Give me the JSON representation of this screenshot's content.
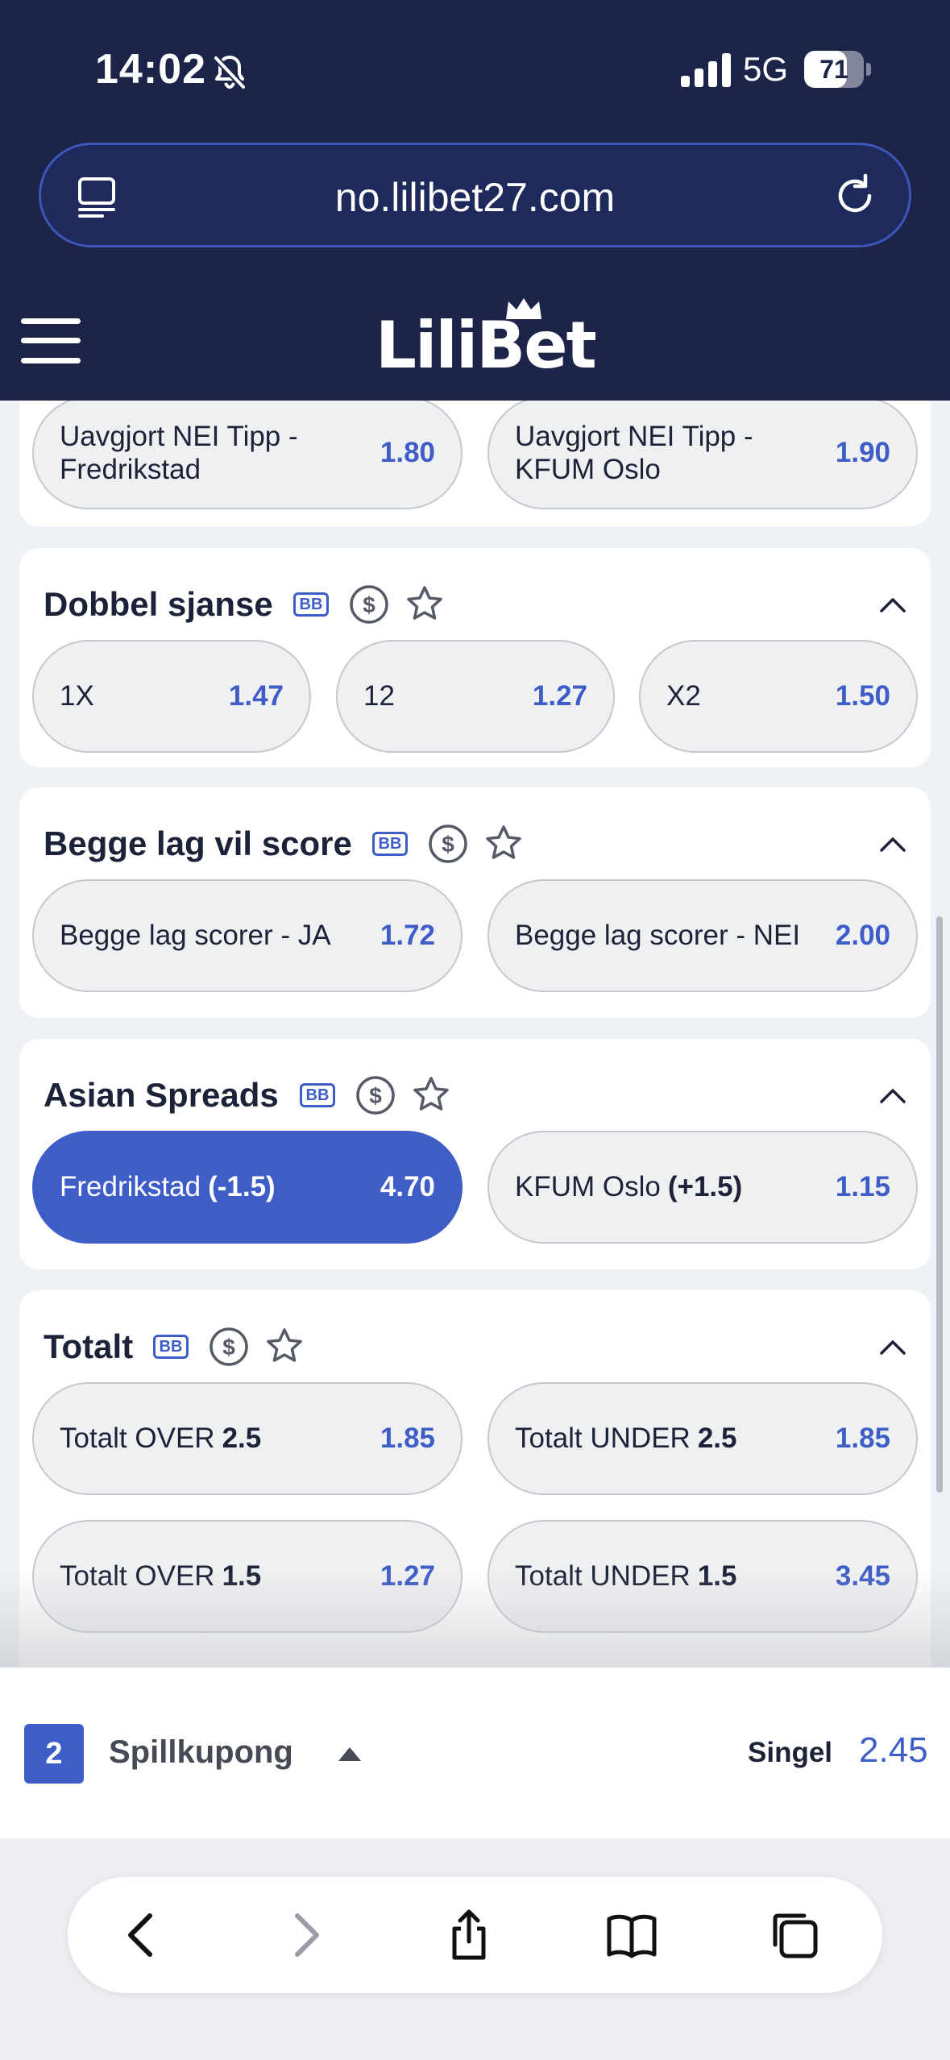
{
  "status_bar": {
    "time": "14:02",
    "network": "5G",
    "battery": "71",
    "battery_level": 0.71
  },
  "browser": {
    "url": "no.lilibet27.com"
  },
  "header": {
    "logo": "LiliBet"
  },
  "partial_card": {
    "odds": [
      {
        "label": "Uavgjort NEI Tipp - Fredrikstad",
        "value": "1.80"
      },
      {
        "label": "Uavgjort NEI Tipp - KFUM Oslo",
        "value": "1.90"
      }
    ]
  },
  "markets": [
    {
      "title": "Dobbel sjanse",
      "badge": "BB",
      "odds": [
        {
          "label": "1X",
          "value": "1.47"
        },
        {
          "label": "12",
          "value": "1.27"
        },
        {
          "label": "X2",
          "value": "1.50"
        }
      ]
    },
    {
      "title": "Begge lag vil score",
      "badge": "BB",
      "odds": [
        {
          "label": "Begge lag scorer - JA",
          "value": "1.72"
        },
        {
          "label": "Begge lag scorer - NEI",
          "value": "2.00"
        }
      ]
    },
    {
      "title": "Asian Spreads",
      "badge": "BB",
      "odds": [
        {
          "label": "Fredrikstad",
          "bold": "(-1.5)",
          "value": "4.70",
          "selected": true
        },
        {
          "label": "KFUM Oslo",
          "bold": "(+1.5)",
          "value": "1.15"
        }
      ]
    },
    {
      "title": "Totalt",
      "badge": "BB",
      "odds": [
        {
          "label": "Totalt OVER",
          "bold": "2.5",
          "value": "1.85"
        },
        {
          "label": "Totalt UNDER",
          "bold": "2.5",
          "value": "1.85"
        },
        {
          "label": "Totalt OVER",
          "bold": "1.5",
          "value": "1.27"
        },
        {
          "label": "Totalt UNDER",
          "bold": "1.5",
          "value": "3.45"
        }
      ]
    }
  ],
  "betslip": {
    "count": "2",
    "label": "Spillkupong",
    "type": "Singel",
    "odds": "2.45"
  },
  "colors": {
    "brand_dark": "#1c2449",
    "accent": "#3f5dc6",
    "odd_bg": "#eff0f2"
  },
  "icons": [
    "bell-slash-icon",
    "signal-icon",
    "battery-icon",
    "page-icon",
    "reload-icon",
    "menu-icon",
    "crown-icon",
    "dollar-icon",
    "star-icon",
    "chevron-up-icon",
    "caret-up-icon",
    "back-icon",
    "forward-icon",
    "share-icon",
    "bookmarks-icon",
    "tabs-icon"
  ]
}
